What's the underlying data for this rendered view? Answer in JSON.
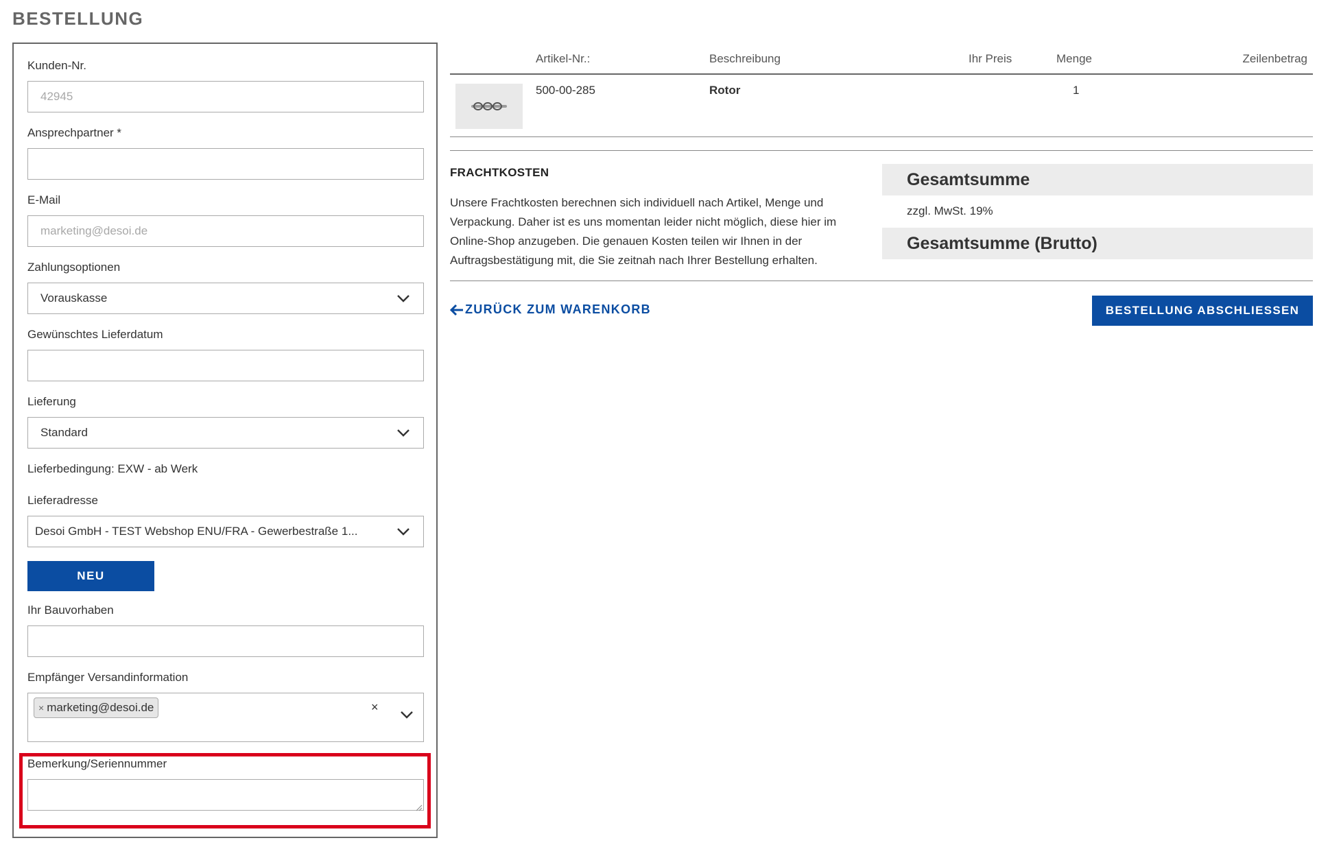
{
  "page": {
    "title": "BESTELLUNG"
  },
  "form": {
    "customer_no": {
      "label": "Kunden-Nr.",
      "value": "42945"
    },
    "contact": {
      "label": "Ansprechpartner *",
      "value": ""
    },
    "email": {
      "label": "E-Mail",
      "placeholder": "marketing@desoi.de"
    },
    "payment": {
      "label": "Zahlungsoptionen",
      "selected": "Vorauskasse"
    },
    "delivery_date": {
      "label": "Gewünschtes Lieferdatum",
      "value": ""
    },
    "delivery": {
      "label": "Lieferung",
      "selected": "Standard"
    },
    "delivery_terms": "Lieferbedingung: EXW - ab Werk",
    "delivery_address": {
      "label": "Lieferadresse",
      "selected": "Desoi GmbH - TEST Webshop ENU/FRA - Gewerbestraße 1..."
    },
    "new_button": "NEU",
    "project": {
      "label": "Ihr Bauvorhaben",
      "value": ""
    },
    "shipping_recipients": {
      "label": "Empfänger Versandinformation",
      "chip_remove": "×",
      "tags": [
        "marketing@desoi.de"
      ],
      "clear": "×"
    },
    "remark": {
      "label": "Bemerkung/Seriennummer",
      "value": ""
    }
  },
  "cart": {
    "columns": [
      "Artikel-Nr.:",
      "Beschreibung",
      "Ihr Preis",
      "Menge",
      "Zeilenbetrag"
    ],
    "items": [
      {
        "article_no": "500-00-285",
        "description": "Rotor",
        "price": "",
        "quantity": "1",
        "line_total": ""
      }
    ]
  },
  "freight": {
    "title": "FRACHTKOSTEN",
    "text": "Unsere Frachtkosten berechnen sich individuell nach Artikel, Menge und Verpackung. Daher ist es uns momentan leider nicht möglich, diese hier im Online-Shop anzugeben. Die genauen Kosten teilen wir Ihnen in der Auftragsbestätigung mit, die Sie zeitnah nach Ihrer Bestellung erhalten."
  },
  "totals": {
    "total_label": "Gesamtsumme",
    "vat_label": "zzgl. MwSt. 19%",
    "gross_label": "Gesamtsumme (Brutto)"
  },
  "actions": {
    "back": "ZURÜCK ZUM WARENKORB",
    "submit": "BESTELLUNG ABSCHLIESSEN"
  },
  "colors": {
    "accent": "#0b4da2",
    "highlight": "#d9001b",
    "panel_border": "#666666",
    "sum_bg": "#ececec"
  }
}
